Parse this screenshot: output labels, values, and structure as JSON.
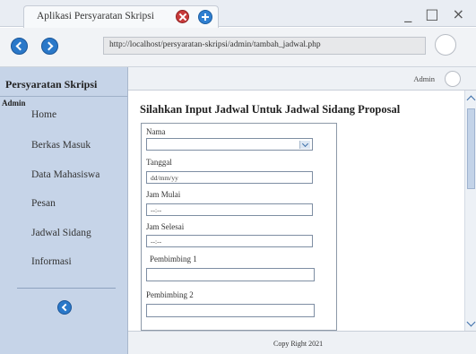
{
  "browser": {
    "tab_title": "Aplikasi Persyaratan Skripsi",
    "window_controls": "_ □ ×",
    "url": "http://localhost/persyaratan-skripsi/admin/tambah_jadwal.php"
  },
  "sidebar": {
    "title": "Persyaratan Skripsi",
    "role": "Admin",
    "items": [
      {
        "label": "Home"
      },
      {
        "label": "Berkas Masuk"
      },
      {
        "label": "Data Mahasiswa"
      },
      {
        "label": "Pesan"
      },
      {
        "label": "Jadwal Sidang"
      },
      {
        "label": "Informasi"
      }
    ]
  },
  "header": {
    "user_label": "Admin"
  },
  "main": {
    "title": "Silahkan Input Jadwal Untuk Jadwal Sidang Proposal",
    "form": {
      "nama_label": "Nama",
      "nama_value": "",
      "tanggal_label": "Tanggal",
      "tanggal_value": "dd/mm/yy",
      "jam_mulai_label": "Jam Mulai",
      "jam_mulai_value": "--:--",
      "jam_selesai_label": "Jam Selesai",
      "jam_selesai_value": "--:--",
      "pembimbing1_label": "Pembimbing 1",
      "pembimbing1_value": "",
      "pembimbing2_label": "Pembimbing 2",
      "pembimbing2_value": ""
    }
  },
  "footer": {
    "text": "Copy Right 2021"
  },
  "colors": {
    "sidebar_bg": "#c6d4e8",
    "accent_blue": "#2a78c9",
    "close_red": "#c83a3a"
  }
}
